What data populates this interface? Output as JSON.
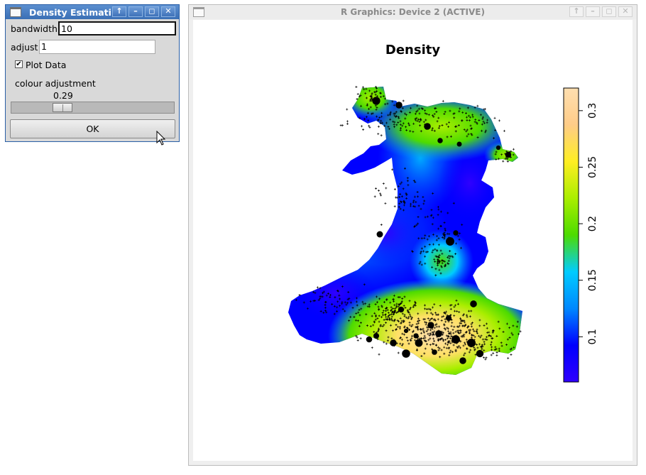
{
  "dialog": {
    "title": "Density Estimati",
    "buttons": {
      "raise": "↑",
      "minimize": "–",
      "maximize": "◻",
      "close": "✕"
    },
    "bandwidth": {
      "label": "bandwidth",
      "value": "10"
    },
    "adjust": {
      "label": "adjust",
      "value": "1"
    },
    "plot_data": {
      "label": "Plot Data",
      "checked": true,
      "mark": "✔"
    },
    "colour_adjustment": {
      "label": "colour adjustment",
      "value": "0.29",
      "fraction": 0.29
    },
    "ok_label": "OK"
  },
  "device": {
    "title": "R Graphics: Device 2 (ACTIVE)",
    "buttons": {
      "raise": "↑",
      "minimize": "–",
      "maximize": "◻",
      "close": "✕"
    },
    "plot_title": "Density",
    "legend_ticks": [
      "0.1",
      "0.15",
      "0.2",
      "0.25",
      "0.3"
    ],
    "legend_tick_values": [
      0.1,
      0.15,
      0.2,
      0.25,
      0.3
    ],
    "legend_range": [
      0.06,
      0.32
    ],
    "colormap": [
      "#2f00ff",
      "#0000ff",
      "#0088ff",
      "#00ccff",
      "#4ddb00",
      "#aaee00",
      "#ffee22",
      "#ffcc88",
      "#ffdfb0"
    ]
  }
}
